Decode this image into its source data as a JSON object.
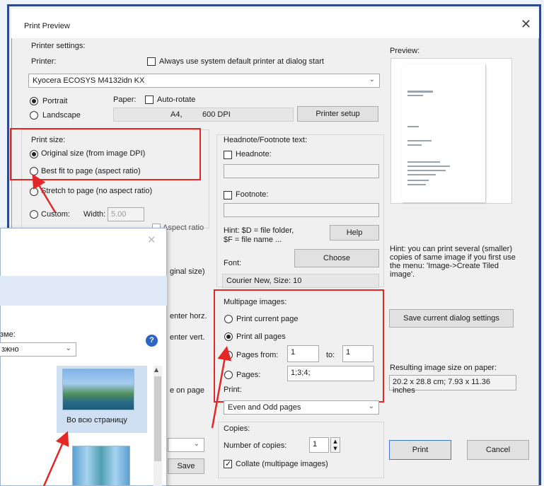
{
  "window": {
    "title": "Print Preview",
    "close_symbol": "✕"
  },
  "printer_settings": {
    "group_label": "Printer settings:",
    "printer_label": "Printer:",
    "always_default_label": "Always use system default printer at dialog start",
    "printer_value": "Kyocera ECOSYS M4132idn KX",
    "portrait_label": "Portrait",
    "landscape_label": "Landscape",
    "paper_label": "Paper:",
    "auto_rotate_label": "Auto-rotate",
    "paper_size": "A4,",
    "dpi": "600 DPI",
    "printer_setup_button": "Printer setup"
  },
  "print_size": {
    "group_label": "Print size:",
    "original_size": "Original size (from image DPI)",
    "best_fit": "Best fit to page (aspect ratio)",
    "stretch": "Stretch to page (no aspect ratio)",
    "custom": "Custom:",
    "width_label": "Width:",
    "width_value": "5.00",
    "aspect_ratio": "Aspect ratio",
    "original_size_suffix": "ginal size)",
    "center_horz": "enter horz.",
    "center_vert": "enter vert.",
    "on_page": "e on page",
    "save_button": "Save"
  },
  "headnote": {
    "group_label": "Headnote/Footnote text:",
    "headnote_label": "Headnote:",
    "footnote_label": "Footnote:",
    "hint": "Hint: $D = file folder,",
    "hint2": "$F = file name ...",
    "help_button": "Help",
    "font_label": "Font:",
    "choose_button": "Choose",
    "font_value": "Courier New, Size: 10"
  },
  "multipage": {
    "group_label": "Multipage images:",
    "print_current": "Print current page",
    "print_all": "Print all pages",
    "pages_from": "Pages from:",
    "from_value": "1",
    "to_label": "to:",
    "to_value": "1",
    "pages_label": "Pages:",
    "pages_value": "1;3;4;",
    "print_label": "Print:",
    "print_option": "Even and Odd pages"
  },
  "copies": {
    "group_label": "Copies:",
    "number_label": "Number of copies:",
    "number_value": "1",
    "collate_label": "Collate (multipage images)"
  },
  "preview": {
    "label": "Preview:",
    "hint_line1": "Hint: you can print several (smaller)",
    "hint_line2": "copies of same image if you first use",
    "hint_line3": "the menu: 'Image->Create Tiled",
    "hint_line4": "image'.",
    "save_settings_button": "Save current dialog settings",
    "resulting_label": "Resulting image size on paper:",
    "resulting_value": "20.2 x 28.8 cm; 7.93 x 11.36 inches",
    "print_button": "Print",
    "cancel_button": "Cancel"
  },
  "overlay": {
    "close_symbol": "✕",
    "field_label_fragment": "зме:",
    "select_fragment": "зжно",
    "help_symbol": "?",
    "thumb_caption": "Во всю страницу"
  },
  "colors": {
    "highlight": "#e32626",
    "frame": "#2c4a86",
    "help_blue": "#2c65c7"
  }
}
